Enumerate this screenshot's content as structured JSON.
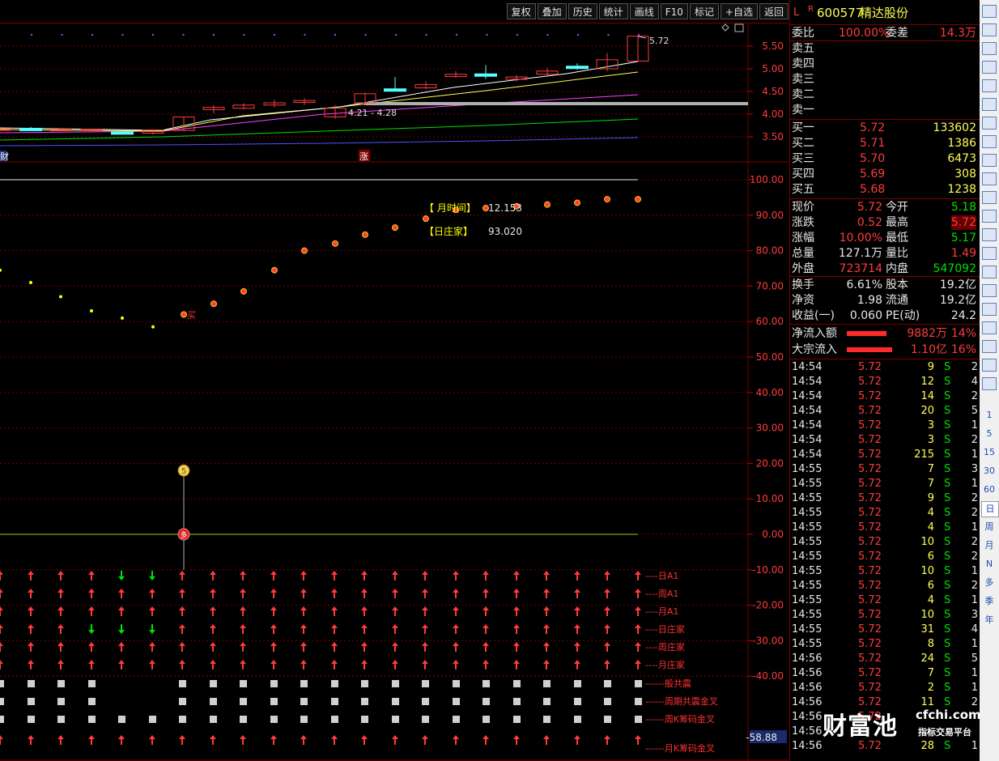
{
  "toolbar": {
    "buttons": [
      "复权",
      "叠加",
      "历史",
      "统计",
      "画线",
      "F10",
      "标记",
      "+自选",
      "返回"
    ]
  },
  "chart": {
    "price_axis": [
      "5.50",
      "5.00",
      "4.50",
      "4.00",
      "3.50"
    ],
    "price_note": "5.72",
    "range_note": "4.21 - 4.28",
    "marker_cai": "财",
    "marker_zhang": "涨",
    "indicator_axis": [
      "100.00",
      "90.00",
      "80.00",
      "70.00",
      "60.00",
      "50.00",
      "40.00",
      "30.00",
      "20.00",
      "10.00",
      "0.00",
      "-10.00",
      "-20.00",
      "-30.00",
      "-40.00"
    ],
    "cursor_value": "-58.88",
    "legend_month_label": "【 月时间】",
    "legend_month_value": "12.153",
    "legend_day_label": "【日庄家】",
    "legend_day_value": "93.020",
    "sell_marker": "5",
    "buy_marker": "多",
    "buy_label": "买",
    "signal_rows": [
      {
        "label": "----日A1",
        "pattern": "RRRRGGRRRRRRRRRRRRRRRR"
      },
      {
        "label": "----周A1",
        "pattern": "RRRRRRRRRRRRRRRRRRRRRR"
      },
      {
        "label": "----月A1",
        "pattern": "RRRRRRRRRRRRRRRRRRRRRR"
      },
      {
        "label": "----日庄家",
        "pattern": "RRRGGGRRRRRRRRRRRRRRRR"
      },
      {
        "label": "----周庄家",
        "pattern": "RRRRRRRRRRRRRRRRRRRRRR"
      },
      {
        "label": "----月庄家",
        "pattern": "RRRRRRRRRRRRRRRRRRRRRR"
      }
    ],
    "square_rows": [
      {
        "label": "------般共震",
        "pattern": "WWWW..WWWWWWWWWWWWWWWW"
      },
      {
        "label": "------周期共震金叉",
        "pattern": "WWWW..WWWWWWWWWWWWWWWW"
      },
      {
        "label": "------周K筹码金叉",
        "pattern": "WWWWWWWWWWWWWWWWWWWWWW"
      }
    ],
    "last_row": {
      "label": "------月K筹码金叉",
      "pattern": "RRRRRRRRRRRRRRRRRRRRRR"
    }
  },
  "header": {
    "flag_l": "L",
    "flag_r": "R",
    "code": "600577",
    "name": "精达股份"
  },
  "order_ratio": {
    "label1": "委比",
    "value1": "100.00%",
    "label2": "委差",
    "value2": "14.3万"
  },
  "sells": [
    "卖五",
    "卖四",
    "卖三",
    "卖二",
    "卖一"
  ],
  "buys": [
    {
      "label": "买一",
      "price": "5.72",
      "vol": "133602"
    },
    {
      "label": "买二",
      "price": "5.71",
      "vol": "1386"
    },
    {
      "label": "买三",
      "price": "5.70",
      "vol": "6473"
    },
    {
      "label": "买四",
      "price": "5.69",
      "vol": "308"
    },
    {
      "label": "买五",
      "price": "5.68",
      "vol": "1238"
    }
  ],
  "quote": [
    {
      "l1": "现价",
      "v1": "5.72",
      "l2": "今开",
      "v2": "5.18"
    },
    {
      "l1": "涨跌",
      "v1": "0.52",
      "l2": "最高",
      "v2": "5.72"
    },
    {
      "l1": "涨幅",
      "v1": "10.00%",
      "l2": "最低",
      "v2": "5.17"
    },
    {
      "l1": "总量",
      "v1": "127.1万",
      "l2": "量比",
      "v2": "1.49"
    },
    {
      "l1": "外盘",
      "v1": "723714",
      "l2": "内盘",
      "v2": "547092"
    }
  ],
  "fundamentals": [
    {
      "l1": "换手",
      "v1": "6.61%",
      "l2": "股本",
      "v2": "19.2亿"
    },
    {
      "l1": "净资",
      "v1": "1.98",
      "l2": "流通",
      "v2": "19.2亿"
    },
    {
      "l1": "收益(一)",
      "v1": "0.060",
      "l2": "PE(动)",
      "v2": "24.2"
    }
  ],
  "flows": [
    {
      "label": "净流入额",
      "value": "9882万",
      "pct": "14%",
      "fill": 0.7
    },
    {
      "label": "大宗流入",
      "value": "1.10亿",
      "pct": "16%",
      "fill": 0.8
    }
  ],
  "ticks": [
    {
      "t": "14:54",
      "p": "5.72",
      "v": "9",
      "s": "S",
      "n": "2"
    },
    {
      "t": "14:54",
      "p": "5.72",
      "v": "12",
      "s": "S",
      "n": "4"
    },
    {
      "t": "14:54",
      "p": "5.72",
      "v": "14",
      "s": "S",
      "n": "2"
    },
    {
      "t": "14:54",
      "p": "5.72",
      "v": "20",
      "s": "S",
      "n": "5"
    },
    {
      "t": "14:54",
      "p": "5.72",
      "v": "3",
      "s": "S",
      "n": "1"
    },
    {
      "t": "14:54",
      "p": "5.72",
      "v": "3",
      "s": "S",
      "n": "2"
    },
    {
      "t": "14:54",
      "p": "5.72",
      "v": "215",
      "s": "S",
      "n": "1"
    },
    {
      "t": "14:55",
      "p": "5.72",
      "v": "7",
      "s": "S",
      "n": "3"
    },
    {
      "t": "14:55",
      "p": "5.72",
      "v": "7",
      "s": "S",
      "n": "1"
    },
    {
      "t": "14:55",
      "p": "5.72",
      "v": "9",
      "s": "S",
      "n": "2"
    },
    {
      "t": "14:55",
      "p": "5.72",
      "v": "4",
      "s": "S",
      "n": "2"
    },
    {
      "t": "14:55",
      "p": "5.72",
      "v": "4",
      "s": "S",
      "n": "1"
    },
    {
      "t": "14:55",
      "p": "5.72",
      "v": "10",
      "s": "S",
      "n": "2"
    },
    {
      "t": "14:55",
      "p": "5.72",
      "v": "6",
      "s": "S",
      "n": "2"
    },
    {
      "t": "14:55",
      "p": "5.72",
      "v": "10",
      "s": "S",
      "n": "1"
    },
    {
      "t": "14:55",
      "p": "5.72",
      "v": "6",
      "s": "S",
      "n": "2"
    },
    {
      "t": "14:55",
      "p": "5.72",
      "v": "4",
      "s": "S",
      "n": "1"
    },
    {
      "t": "14:55",
      "p": "5.72",
      "v": "10",
      "s": "S",
      "n": "3"
    },
    {
      "t": "14:55",
      "p": "5.72",
      "v": "31",
      "s": "S",
      "n": "4"
    },
    {
      "t": "14:55",
      "p": "5.72",
      "v": "8",
      "s": "S",
      "n": "1"
    },
    {
      "t": "14:56",
      "p": "5.72",
      "v": "24",
      "s": "S",
      "n": "5"
    },
    {
      "t": "14:56",
      "p": "5.72",
      "v": "7",
      "s": "S",
      "n": "1"
    },
    {
      "t": "14:56",
      "p": "5.72",
      "v": "2",
      "s": "S",
      "n": "1"
    },
    {
      "t": "14:56",
      "p": "5.72",
      "v": "11",
      "s": "S",
      "n": "2"
    },
    {
      "t": "14:56",
      "p": "5.72",
      "v": "",
      "s": "",
      "n": ""
    },
    {
      "t": "14:56",
      "p": "",
      "v": "",
      "s": "",
      "n": ""
    },
    {
      "t": "14:56",
      "p": "5.72",
      "v": "28",
      "s": "S",
      "n": "1"
    }
  ],
  "watermark": {
    "brand": "财富池",
    "site": "cfchi.com",
    "tag": "指标交易平台"
  },
  "sidebar_periods": [
    "1",
    "5",
    "15",
    "30",
    "60",
    "日",
    "周",
    "月",
    "N",
    "多",
    "季",
    "年"
  ],
  "colors": {
    "up": "#ff3b3b",
    "down": "#00e000",
    "ma5": "#ffffff",
    "ma10": "#ffff54",
    "ma20": "#ff40ff",
    "ma30": "#00e000",
    "ma60": "#5050ff",
    "signal_yellow": "#ffff00"
  }
}
